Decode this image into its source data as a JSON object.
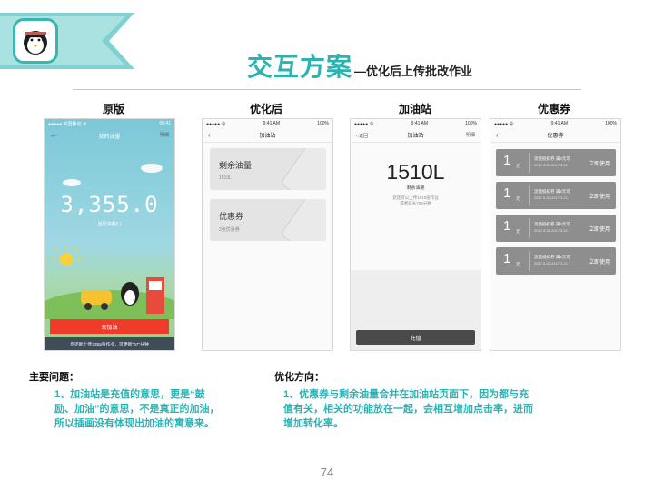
{
  "header": {
    "title": "交互方案",
    "subtitle": "—优化后上传批改作业"
  },
  "columns": [
    "原版",
    "优化后",
    "加油站",
    "优惠券"
  ],
  "phone_original": {
    "status_carrier": "●●●●● 中国移动 令",
    "status_time": "09:41",
    "nav_title": "我的油量",
    "nav_right": "明细",
    "big_value": "3,355.0",
    "sub_label": "当前油量(L)",
    "button": "去加油",
    "footer": "您还能上传3355张作业，可更新\"67\"分钟"
  },
  "phone_optimized": {
    "status_carrier": "●●●●● 令",
    "status_time": "9:41 AM",
    "status_battery": "100%",
    "nav_title": "加油站",
    "cards": [
      {
        "title": "剩余油量",
        "sub": "1510L"
      },
      {
        "title": "优惠券",
        "sub": "2张优惠券"
      }
    ]
  },
  "phone_station": {
    "status_carrier": "●●●●● 令",
    "status_time": "9:41 AM",
    "status_battery": "100%",
    "nav_back": "返回",
    "nav_title": "加油站",
    "nav_right": "明细",
    "big_value": "1510L",
    "label": "剩余油量",
    "note_line1": "您还可以上传1510张作业",
    "note_line2": "或者延长755分钟",
    "button": "充值"
  },
  "phone_coupon": {
    "status_carrier": "●●●●● 令",
    "status_time": "9:41 AM",
    "status_battery": "100%",
    "nav_title": "优惠券",
    "coupons": [
      {
        "num": "1",
        "unit": "元",
        "title": "流量抵扣券  满5元可",
        "date": "2017.3.20-2017.3.21",
        "action": "立即使用"
      },
      {
        "num": "1",
        "unit": "元",
        "title": "流量抵扣券  满5元可",
        "date": "2017.3.20-2017.3.21",
        "action": "立即使用"
      },
      {
        "num": "1",
        "unit": "元",
        "title": "流量抵扣券  满5元可",
        "date": "2017.3.20-2017.3.21",
        "action": "立即使用"
      },
      {
        "num": "1",
        "unit": "元",
        "title": "流量抵扣券  满5元可",
        "date": "2017.3.20-2017.3.21",
        "action": "立即使用"
      }
    ]
  },
  "problems": {
    "title": "主要问题：",
    "line1": "1、加油站是充值的意思，更是“鼓",
    "line2": "励、加油”的意思，不是真正的加油，",
    "line3": "所以插画没有体现出加油的寓意来。"
  },
  "direction": {
    "title": "优化方向：",
    "line1": "1、优惠券与剩余油量合并在加油站页面下，因为都与充",
    "line2": "值有关，相关的功能放在一起，会相互增加点击率，进而",
    "line3": "增加转化率。"
  },
  "page_number": "74",
  "colors": {
    "accent": "#2bb3b4",
    "red_button": "#f03b2a",
    "dark_button": "#4a4a4a",
    "coupon": "#8e8e8e"
  }
}
